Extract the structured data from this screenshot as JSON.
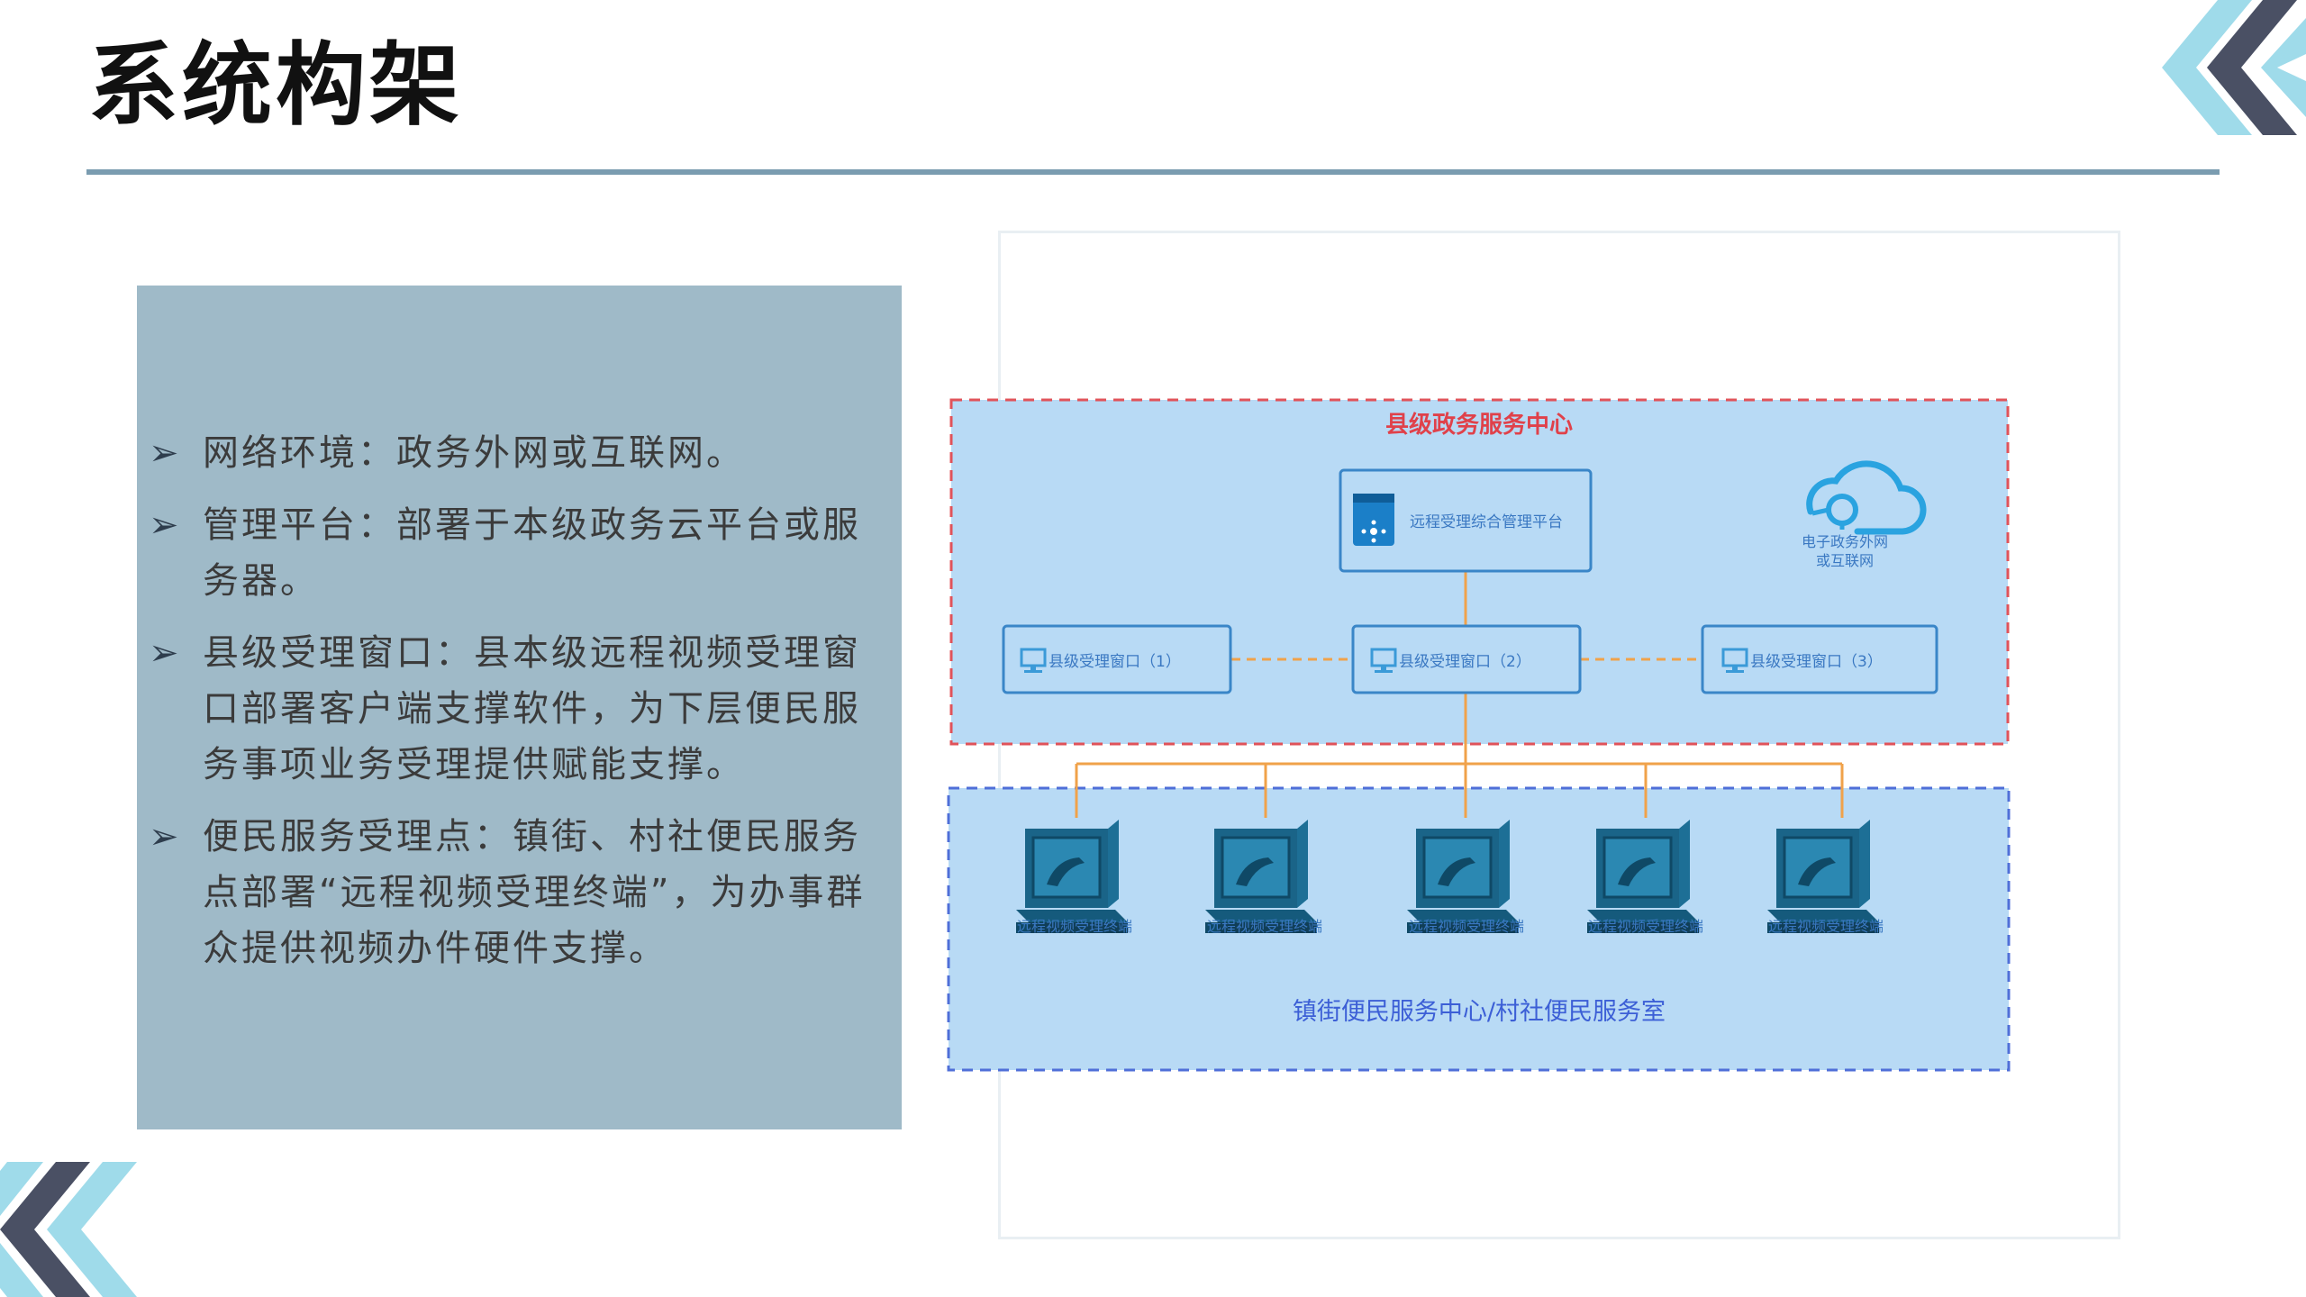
{
  "page": {
    "title": "系统构架"
  },
  "bullets": [
    {
      "text": "网络环境：政务外网或互联网。"
    },
    {
      "text": "管理平台：部署于本级政务云平台或服务器。"
    },
    {
      "text": "县级受理窗口：县本级远程视频受理窗口部署客户端支撑软件，为下层便民服务事项业务受理提供赋能支撑。"
    },
    {
      "text": "便民服务受理点：镇街、村社便民服务点部署“远程视频受理终端”，为办事群众提供视频办件硬件支撑。"
    }
  ],
  "diagram": {
    "county_zone": {
      "title": "县级政务服务中心",
      "platform": "远程受理综合管理平台",
      "cloud_line1": "电子政务外网",
      "cloud_line2": "或互联网",
      "windows": [
        "县级受理窗口（1）",
        "县级受理窗口（2）",
        "县级受理窗口（3）"
      ]
    },
    "town_zone": {
      "title": "镇街便民服务中心/村社便民服务室",
      "terminals": [
        "远程视频受理终端",
        "远程视频受理终端",
        "远程视频受理终端",
        "远程视频受理终端",
        "远程视频受理终端"
      ]
    }
  },
  "colors": {
    "title_rule": "#7a9cb0",
    "panel_bg": "#9fbac8",
    "zone_fill": "#b8daf5",
    "county_border": "#e0535a",
    "town_border": "#4f6fd8",
    "connector": "#f0a24a",
    "county_title": "#e0414a",
    "town_title": "#3c5fd6",
    "node_text": "#3a78c2",
    "terminal_dark": "#155a7c",
    "deco_light": "#9fdbea",
    "deco_dark": "#4a5064"
  },
  "icons": {
    "bullet": "arrowhead-bullet-icon",
    "platform": "server-icon",
    "cloud": "cloud-network-icon",
    "window": "monitor-icon",
    "terminal": "video-terminal-icon"
  }
}
